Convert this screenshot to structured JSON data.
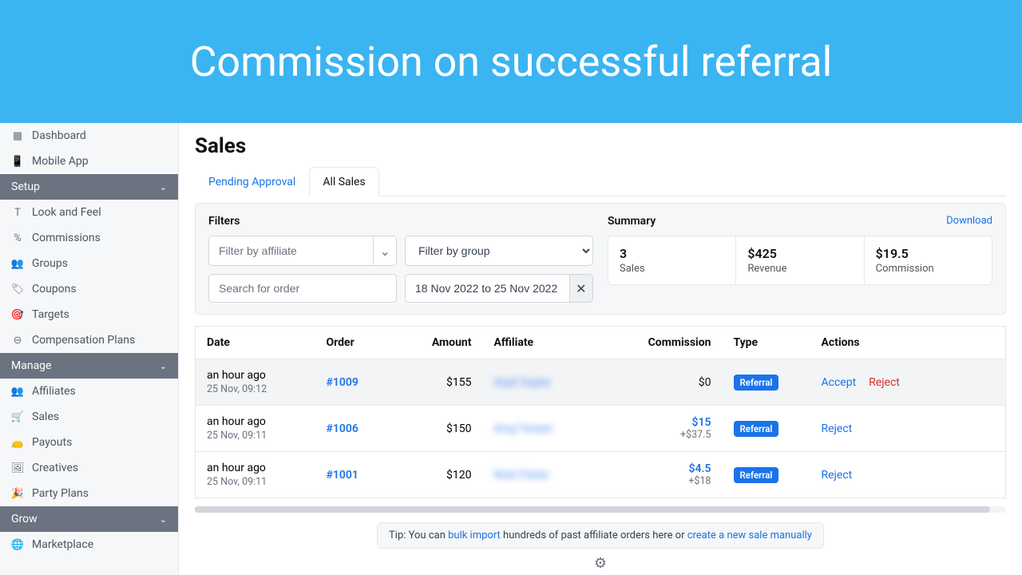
{
  "banner": {
    "title": "Commission on successful referral"
  },
  "sidebar": {
    "top": [
      {
        "icon": "grid",
        "label": "Dashboard"
      },
      {
        "icon": "phone",
        "label": "Mobile App"
      }
    ],
    "sections": [
      {
        "title": "Setup",
        "items": [
          {
            "icon": "T",
            "label": "Look and Feel"
          },
          {
            "icon": "%",
            "label": "Commissions"
          },
          {
            "icon": "people",
            "label": "Groups"
          },
          {
            "icon": "tag",
            "label": "Coupons"
          },
          {
            "icon": "target",
            "label": "Targets"
          },
          {
            "icon": "dollar",
            "label": "Compensation Plans"
          }
        ]
      },
      {
        "title": "Manage",
        "items": [
          {
            "icon": "people",
            "label": "Affiliates"
          },
          {
            "icon": "cart",
            "label": "Sales"
          },
          {
            "icon": "wallet",
            "label": "Payouts"
          },
          {
            "icon": "image",
            "label": "Creatives"
          },
          {
            "icon": "party",
            "label": "Party Plans"
          }
        ]
      },
      {
        "title": "Grow",
        "items": [
          {
            "icon": "globe",
            "label": "Marketplace"
          }
        ]
      }
    ]
  },
  "page": {
    "title": "Sales"
  },
  "tabs": {
    "pending": "Pending Approval",
    "all": "All Sales"
  },
  "filters": {
    "label": "Filters",
    "affiliate_placeholder": "Filter by affiliate",
    "group_placeholder": "Filter by group",
    "search_placeholder": "Search for order",
    "date_value": "18 Nov 2022 to 25 Nov 2022"
  },
  "summary": {
    "label": "Summary",
    "download": "Download",
    "cards": [
      {
        "value": "3",
        "label": "Sales"
      },
      {
        "value": "$425",
        "label": "Revenue"
      },
      {
        "value": "$19.5",
        "label": "Commission"
      }
    ]
  },
  "table": {
    "headers": {
      "date": "Date",
      "order": "Order",
      "amount": "Amount",
      "affiliate": "Affiliate",
      "commission": "Commission",
      "type": "Type",
      "actions": "Actions"
    },
    "rows": [
      {
        "highlight": true,
        "date": "an hour ago",
        "date_sub": "25 Nov, 09:12",
        "order": "#1009",
        "amount": "$155",
        "affiliate": "Arpit Gupta",
        "commission": "$0",
        "commission_sub": "",
        "type": "Referral",
        "actions": [
          "Accept",
          "Reject"
        ]
      },
      {
        "highlight": false,
        "date": "an hour ago",
        "date_sub": "25 Nov, 09:11",
        "order": "#1006",
        "amount": "$150",
        "affiliate": "Anuj Tenani",
        "commission": "$15",
        "commission_sub": "+$37.5",
        "type": "Referral",
        "actions": [
          "Reject"
        ]
      },
      {
        "highlight": false,
        "date": "an hour ago",
        "date_sub": "25 Nov, 09:11",
        "order": "#1001",
        "amount": "$120",
        "affiliate": "Nick Fisher",
        "commission": "$4.5",
        "commission_sub": "+$18",
        "type": "Referral",
        "actions": [
          "Reject"
        ]
      }
    ]
  },
  "tip": {
    "pre": "Tip: You can ",
    "link1": "bulk import",
    "mid": " hundreds of past affiliate orders here or ",
    "link2": "create a new sale manually"
  },
  "icons": {
    "grid": "▦",
    "phone": "📱",
    "T": "T",
    "%": "%",
    "people": "👥",
    "tag": "🏷",
    "target": "🎯",
    "dollar": "⊖",
    "cart": "🛒",
    "wallet": "👝",
    "image": "🖼",
    "party": "🎉",
    "globe": "🌐",
    "gear": "⚙",
    "chev": "⌄",
    "x": "✕"
  }
}
